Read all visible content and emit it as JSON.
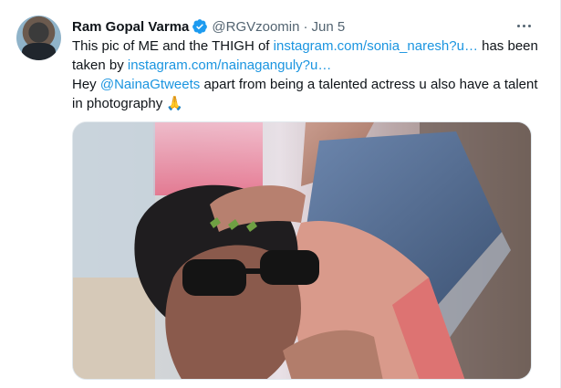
{
  "tweet": {
    "author_name": "Ram Gopal Varma",
    "handle": "@RGVzoomin",
    "dot": "·",
    "date": "Jun 5",
    "text_line1_prefix": "This pic of ME and the THIGH of ",
    "link1": "instagram.com/sonia_naresh?u…",
    "text_line1_suffix": " has been",
    "text_line2_prefix": "taken by ",
    "link2": "instagram.com/nainaganguly?u…",
    "text_line3_prefix": "Hey ",
    "mention": "@NainaGtweets",
    "text_line3_suffix": " apart from being a talented actress u also have a talent",
    "text_line4": "in photography 🙏"
  },
  "colors": {
    "link": "#1b95e0",
    "verified": "#1d9bf0",
    "secondary_text": "#536471"
  },
  "icons": {
    "verified": "verified-badge-icon",
    "more": "more-options-icon"
  }
}
